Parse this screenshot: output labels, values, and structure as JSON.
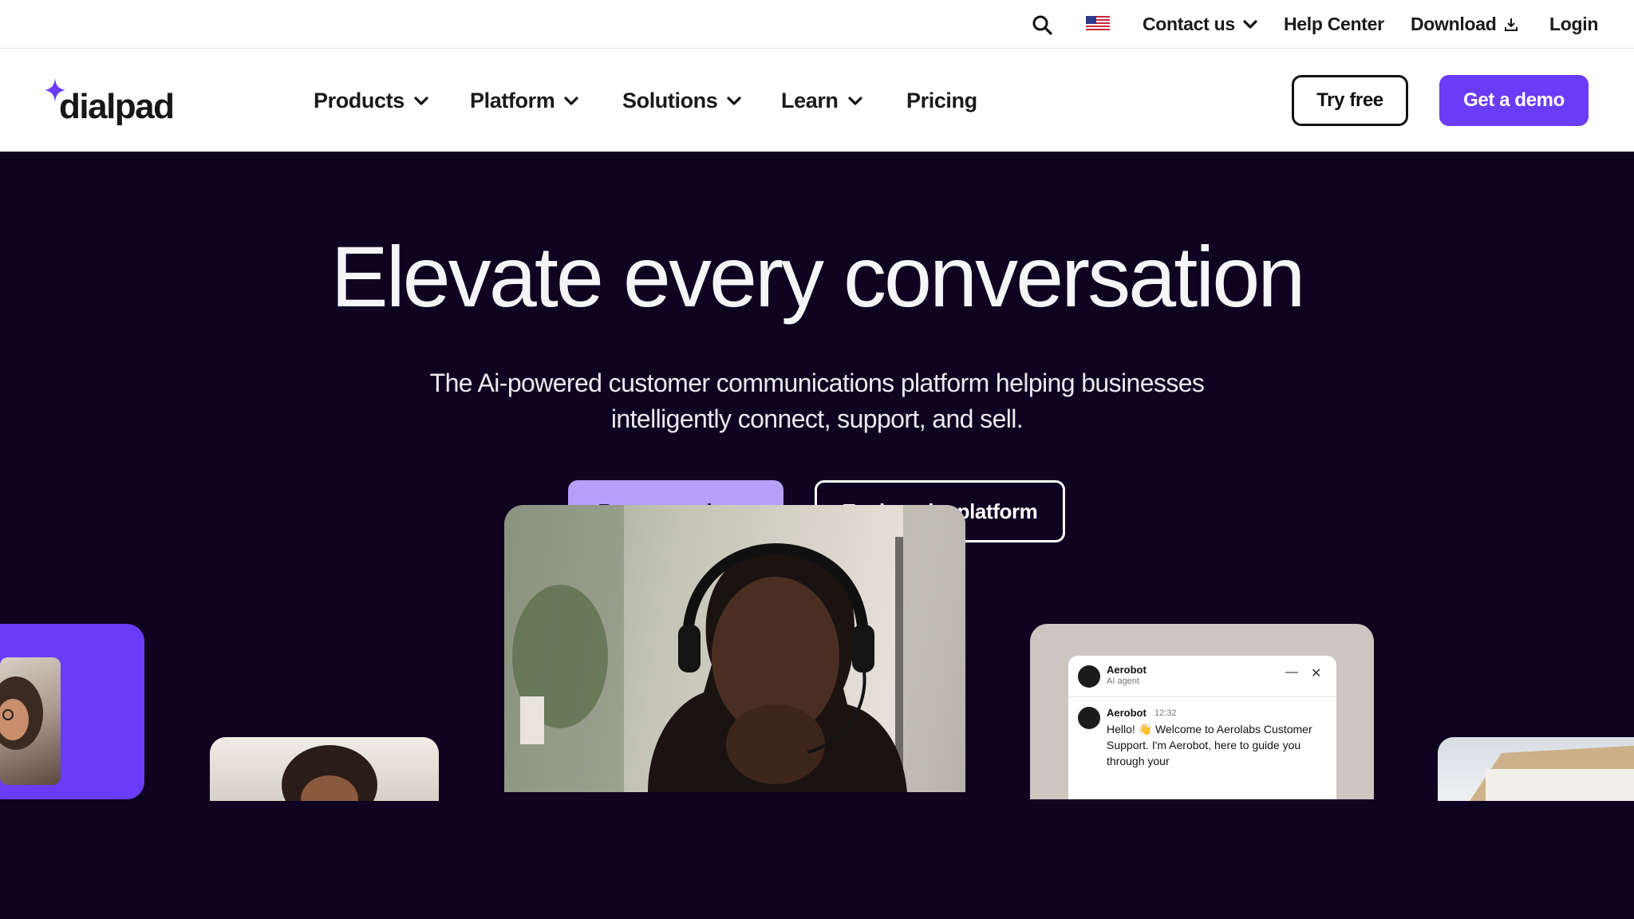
{
  "utility_bar": {
    "contact_label": "Contact us",
    "help_label": "Help Center",
    "download_label": "Download",
    "login_label": "Login"
  },
  "nav": {
    "logo_text": "dialpad",
    "items": [
      {
        "label": "Products",
        "has_dropdown": true
      },
      {
        "label": "Platform",
        "has_dropdown": true
      },
      {
        "label": "Solutions",
        "has_dropdown": true
      },
      {
        "label": "Learn",
        "has_dropdown": true
      },
      {
        "label": "Pricing",
        "has_dropdown": false
      }
    ],
    "try_free_label": "Try free",
    "get_demo_label": "Get a demo"
  },
  "hero": {
    "title": "Elevate every conversation",
    "subtitle_line1": "The Ai-powered customer communications platform helping businesses",
    "subtitle_line2": "intelligently connect, support, and sell.",
    "request_demo_label": "Request a demo",
    "explore_label": "Explore the platform"
  },
  "chat_widget": {
    "bot_name": "Aerobot",
    "bot_role": "AI agent",
    "msg_sender": "Aerobot",
    "msg_time": "12:32",
    "msg_text": "Hello! 👋 Welcome to Aerolabs Customer Support. I'm Aerobot, here to guide you through your"
  },
  "colors": {
    "brand_purple": "#6b3cf7",
    "hero_bg": "#0e0320",
    "request_demo_bg": "#b69ef9"
  }
}
